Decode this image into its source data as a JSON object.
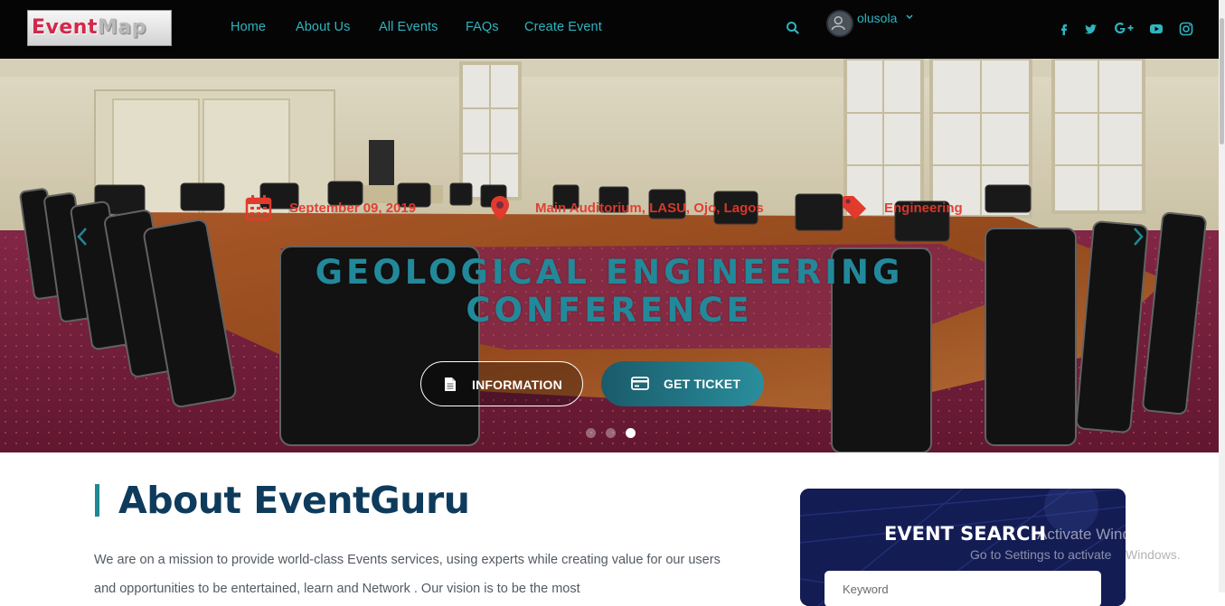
{
  "brand": {
    "logo_part1": "Event",
    "logo_part2": "Map"
  },
  "nav": {
    "links": [
      "Home",
      "About Us",
      "All Events",
      "FAQs",
      "Create Event"
    ],
    "user": "olusola",
    "social_icons": [
      "facebook-icon",
      "twitter-icon",
      "google-plus-icon",
      "youtube-icon",
      "instagram-icon"
    ]
  },
  "hero": {
    "date": "September 09, 2019",
    "location": "Main Auditorium, LASU, Ojo, Lagos",
    "category": "Engineering",
    "title_line1": "GEOLOGICAL ENGINEERING",
    "title_line2": "CONFERENCE",
    "info_button": "INFORMATION",
    "ticket_button": "GET TICKET",
    "slides": 3,
    "active_slide": 3
  },
  "about": {
    "title": "About EventGuru",
    "text": "We are on a mission to provide world-class Events services, using experts while creating value for our users and opportunities to be entertained, learn and Network . Our vision is to be the most"
  },
  "search": {
    "title": "EVENT SEARCH",
    "placeholder": "Keyword"
  },
  "watermark": {
    "line1": "Activate Windows",
    "line2": "Go to Settings to activate",
    "line2_end": "Windows."
  },
  "colors": {
    "accent": "#2fb4c0",
    "hero_meta": "#e23a2c",
    "heading": "#0e3b5c",
    "title_teal": "#22899a"
  }
}
